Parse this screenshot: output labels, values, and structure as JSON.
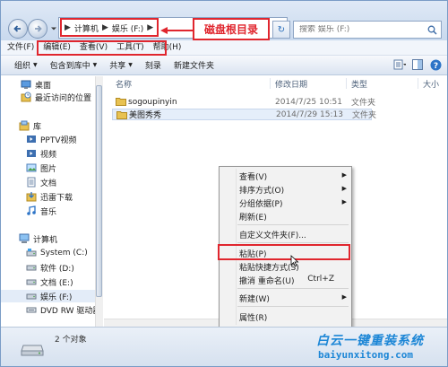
{
  "address": {
    "crumbs": [
      "计算机",
      "娱乐 (F:)"
    ],
    "annotation": "磁盘根目录",
    "search_placeholder": "搜索 娱乐 (F:)"
  },
  "menubar": [
    "文件(F)",
    "编辑(E)",
    "查看(V)",
    "工具(T)",
    "帮助(H)"
  ],
  "commandbar": [
    {
      "label": "组织",
      "dropdown": true
    },
    {
      "label": "包含到库中",
      "dropdown": true
    },
    {
      "label": "共享",
      "dropdown": true
    },
    {
      "label": "刻录",
      "dropdown": false
    },
    {
      "label": "新建文件夹",
      "dropdown": false
    }
  ],
  "sidebar": {
    "items": [
      {
        "label": "桌面",
        "icon": "desktop-icon"
      },
      {
        "label": "最近访问的位置",
        "icon": "recent-places-icon"
      },
      {
        "label": "库",
        "icon": "library-icon"
      },
      {
        "label": "PPTV视频",
        "icon": "video-library-icon"
      },
      {
        "label": "视频",
        "icon": "video-library-icon"
      },
      {
        "label": "图片",
        "icon": "picture-library-icon"
      },
      {
        "label": "文档",
        "icon": "document-library-icon"
      },
      {
        "label": "迅雷下载",
        "icon": "download-library-icon"
      },
      {
        "label": "音乐",
        "icon": "music-library-icon"
      },
      {
        "label": "计算机",
        "icon": "computer-icon"
      },
      {
        "label": "System (C:)",
        "icon": "system-drive-icon"
      },
      {
        "label": "软件 (D:)",
        "icon": "drive-icon"
      },
      {
        "label": "文档 (E:)",
        "icon": "drive-icon"
      },
      {
        "label": "娱乐 (F:)",
        "icon": "drive-icon"
      },
      {
        "label": "DVD RW 驱动器",
        "icon": "dvd-drive-icon"
      }
    ]
  },
  "columns": {
    "name": "名称",
    "date": "修改日期",
    "type": "类型",
    "size": "大小"
  },
  "files": [
    {
      "name": "sogoupinyin",
      "date": "2014/7/25 10:51",
      "type": "文件夹"
    },
    {
      "name": "美图秀秀",
      "date": "2014/7/29 15:13",
      "type": "文件夹"
    }
  ],
  "context_menu": {
    "items": [
      {
        "label": "查看(V)",
        "shortcut": "",
        "submenu": true
      },
      {
        "label": "排序方式(O)",
        "shortcut": "",
        "submenu": true
      },
      {
        "label": "分组依据(P)",
        "shortcut": "",
        "submenu": true
      },
      {
        "label": "刷新(E)",
        "shortcut": "",
        "submenu": false
      },
      {
        "label": "自定义文件夹(F)...",
        "shortcut": "",
        "submenu": false
      },
      {
        "label": "粘贴(P)",
        "shortcut": "",
        "submenu": false
      },
      {
        "label": "粘贴快捷方式(S)",
        "shortcut": "",
        "submenu": false
      },
      {
        "label": "撤消 重命名(U)",
        "shortcut": "Ctrl+Z",
        "submenu": false
      },
      {
        "label": "新建(W)",
        "shortcut": "",
        "submenu": true
      },
      {
        "label": "属性(R)",
        "shortcut": "",
        "submenu": false
      }
    ]
  },
  "status": {
    "count": "2 个对象"
  },
  "watermark": {
    "cn": "白云一键重装系统",
    "en": "baiyunxitong.com"
  },
  "colors": {
    "highlight": "#e0262e",
    "watermark": "#1c86d6",
    "folder": "#e8c252"
  }
}
